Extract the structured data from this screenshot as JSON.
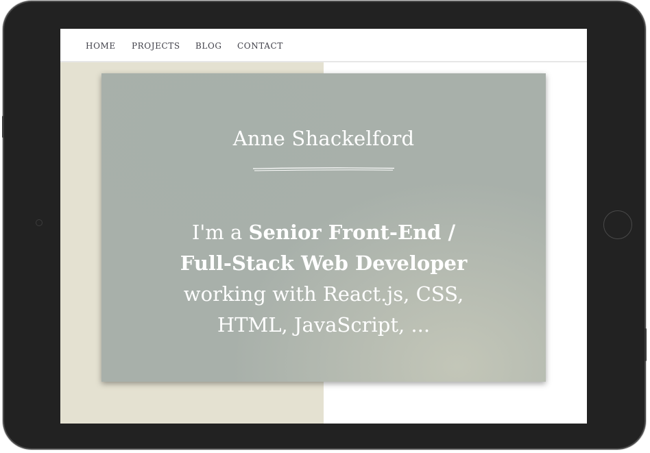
{
  "colors": {
    "device_frame": "#222222",
    "left_panel": "#e4e1d1",
    "hero_card": "#a8b0aa",
    "nav_text": "#3f3f48",
    "hero_text": "#ffffff"
  },
  "nav": {
    "items": [
      {
        "label": "HOME"
      },
      {
        "label": "PROJECTS"
      },
      {
        "label": "BLOG"
      },
      {
        "label": "CONTACT"
      }
    ]
  },
  "hero": {
    "name": "Anne Shackelford",
    "tagline_prefix": "I'm a ",
    "tagline_role": "Senior Front-End / Full-Stack Web Developer",
    "tagline_suffix": " working with React.js, CSS, HTML, JavaScript, ..."
  },
  "device": {
    "home_button_icon": "home-button-icon",
    "camera_icon": "camera-icon"
  }
}
